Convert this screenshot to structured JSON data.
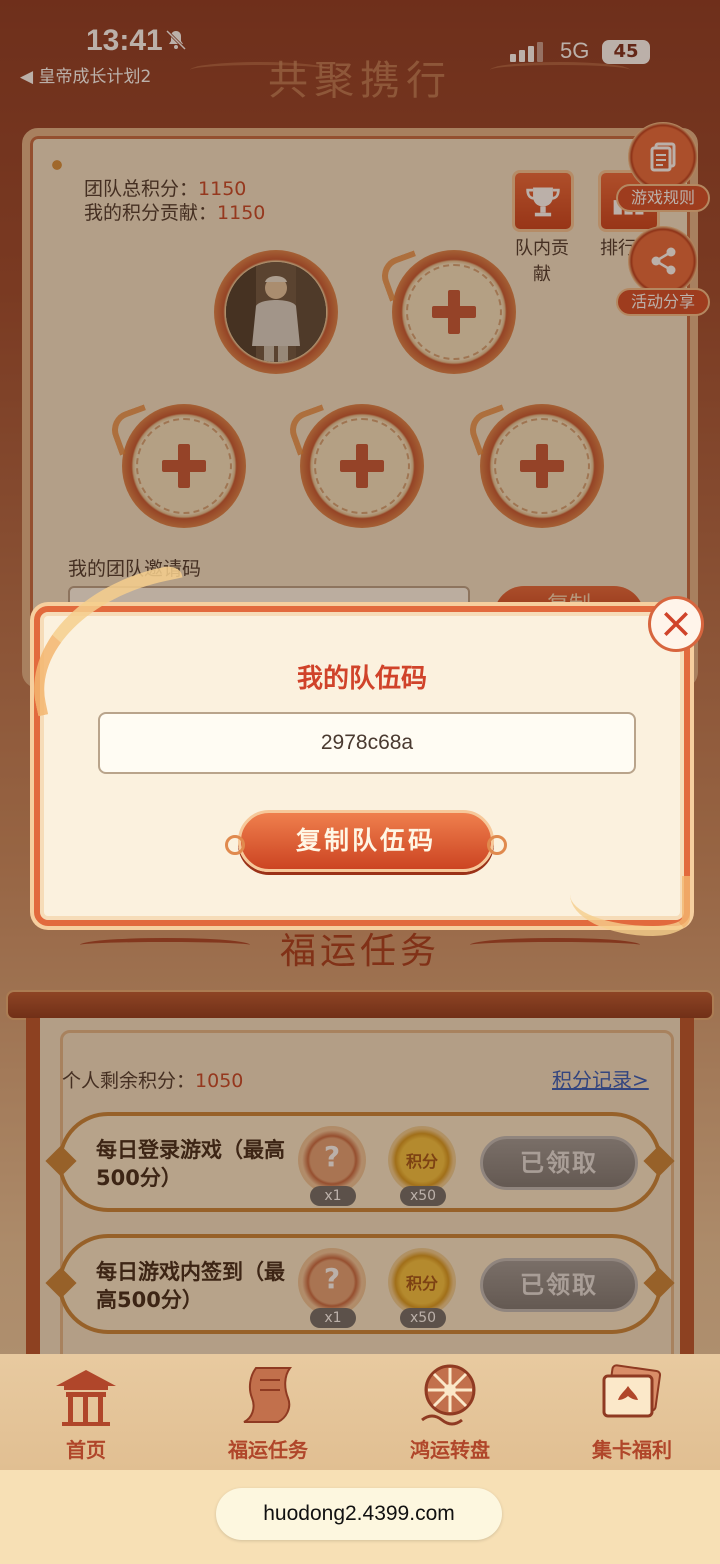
{
  "status_bar": {
    "time": "13:41",
    "back_app": "◀ 皇帝成长计划2",
    "network": "5G",
    "battery": "45"
  },
  "header": {
    "title": "共聚携行"
  },
  "team": {
    "total_score_label": "团队总积分：",
    "total_score": "1150",
    "my_contribution_label": "我的积分贡献：",
    "my_contribution": "1150",
    "team_contribution_label": "队内贡献",
    "ranking_label": "排行",
    "invite_code_label": "我的团队邀请码",
    "copy_label": "复制",
    "icons": {
      "team_contribution": "trophy-icon",
      "ranking": "ranking-icon"
    }
  },
  "side_buttons": [
    {
      "label": "游戏规则",
      "icon": "rules-document-icon"
    },
    {
      "label": "活动分享",
      "icon": "share-icon"
    }
  ],
  "modal": {
    "title": "我的队伍码",
    "team_code": "2978c68a",
    "copy_button": "复制队伍码"
  },
  "tasks_section": {
    "title": "福运任务",
    "remaining_label": "个人剩余积分：",
    "remaining_points": "1050",
    "record_link": "积分记录>",
    "tasks": [
      {
        "name": "每日登录游戏（最高500分）",
        "mystery_reward": "?",
        "mystery_count": "x1",
        "points_reward": "积分",
        "points_count": "x50",
        "button": "已领取"
      },
      {
        "name": "每日游戏内签到（最高500分）",
        "mystery_reward": "?",
        "mystery_count": "x1",
        "points_reward": "积分",
        "points_count": "x50",
        "button": "已领取"
      }
    ]
  },
  "bottom_nav": [
    {
      "label": "首页",
      "icon": "pavilion-icon"
    },
    {
      "label": "福运任务",
      "icon": "scroll-icon"
    },
    {
      "label": "鸿运转盘",
      "icon": "wheel-icon"
    },
    {
      "label": "集卡福利",
      "icon": "cards-icon"
    }
  ],
  "browser": {
    "url": "huodong2.4399.com"
  },
  "colors": {
    "accent": "#d0432a",
    "brand_dark": "#8a3a26",
    "link": "#2f5bbf",
    "claimed": "#8a8a8a"
  }
}
